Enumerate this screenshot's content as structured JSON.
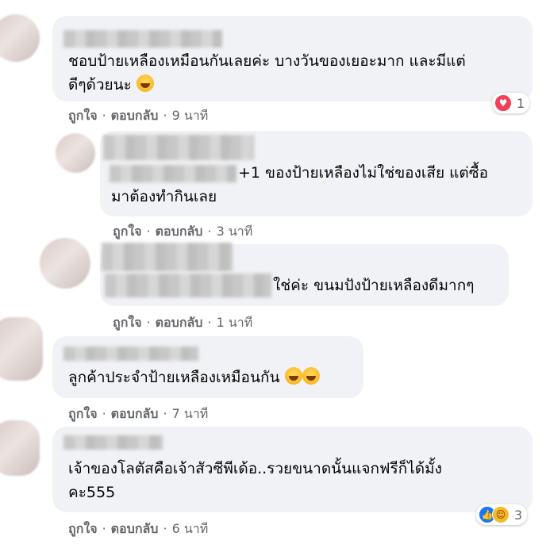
{
  "comments": [
    {
      "text": "ชอบป้ายเหลืองเหมือนกันเลยค่ะ บางวันของเยอะมาก และมีแต่\nดีๆด้วยนะ",
      "emoji": "laughing-emoji",
      "actions": {
        "like": "ถูกใจ",
        "reply": "ตอบกลับ",
        "time": "9 นาที"
      },
      "reactions": {
        "icons": [
          "love-icon"
        ],
        "count": "1"
      }
    },
    {
      "text": "+1 ของป้ายเหลืองไม่ใช่ของเสีย แต่ซื้อ\nมาต้องทำกินเลย",
      "actions": {
        "like": "ถูกใจ",
        "reply": "ตอบกลับ",
        "time": "3 นาที"
      }
    },
    {
      "text": "ใช่ค่ะ ขนมปังป้ายเหลืองดีมากๆ",
      "actions": {
        "like": "ถูกใจ",
        "reply": "ตอบกลับ",
        "time": "1 นาที"
      }
    },
    {
      "text": "ลูกค้าประจำป้ายเหลืองเหมือนกัน",
      "emoji": "grinning-emoji",
      "actions": {
        "like": "ถูกใจ",
        "reply": "ตอบกลับ",
        "time": "7 นาที"
      }
    },
    {
      "text": "เจ้าของโลตัสคือเจ้าสัวซีพีเด้อ..รวยขนาดนั้นแจกฟรีก็ได้มั้ง\nคะ555",
      "actions": {
        "like": "ถูกใจ",
        "reply": "ตอบกลับ",
        "time": "6 นาที"
      },
      "reactions": {
        "icons": [
          "like-icon",
          "haha-icon"
        ],
        "count": "3"
      }
    }
  ],
  "separator": "·",
  "colors": {
    "bubble": "#f0f2f5",
    "meta": "#65676b",
    "love": "#f33e58",
    "like": "#1877f2"
  }
}
